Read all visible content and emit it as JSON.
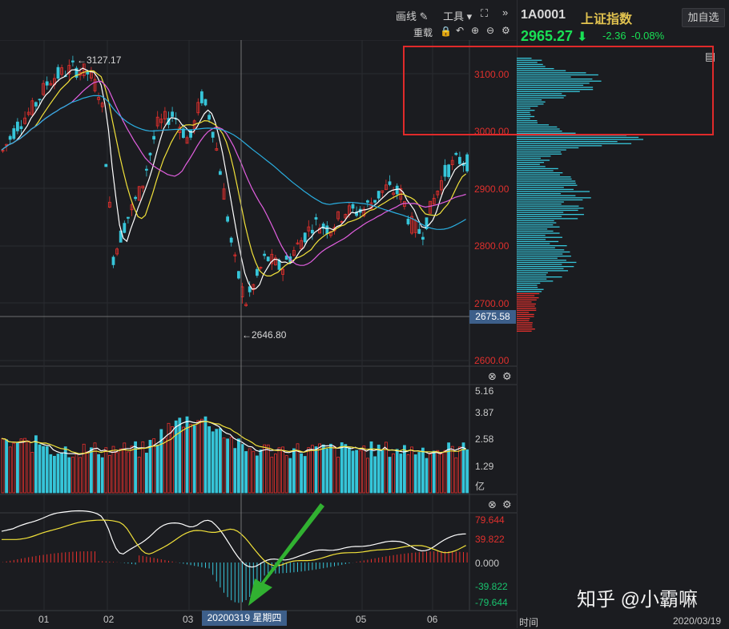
{
  "toolbar": {
    "draw_label": "画线",
    "tools_label": "工具",
    "reload_label": "重载",
    "more_label": "»"
  },
  "quote": {
    "code": "1A0001",
    "name": "上证指数",
    "add_favorite": "加自选",
    "price": "2965.27",
    "change": "-2.36",
    "change_pct": "-0.08%"
  },
  "price_axis": [
    "3100.00",
    "3000.00",
    "2900.00",
    "2800.00",
    "2700.00",
    "2600.00"
  ],
  "volume_axis": [
    "5.16",
    "3.87",
    "2.58",
    "1.29",
    "亿"
  ],
  "macd_axis": {
    "pos": [
      "79.644",
      "39.822"
    ],
    "zero": "0.000",
    "neg": [
      "-39.822",
      "-79.644"
    ]
  },
  "time_axis": [
    "01",
    "02",
    "03",
    "05",
    "06"
  ],
  "annotations": {
    "high": "←3127.17",
    "low": "←2646.80",
    "crosshair_price": "2675.58",
    "crosshair_date": "20200319 星期四"
  },
  "colors": {
    "up": "#e8302d",
    "down": "#36c5d9",
    "ma5": "#ffffff",
    "ma10": "#f2e23a",
    "ma20": "#e25fe0",
    "ma60": "#2aaee0",
    "highlight": "#e02a2a",
    "arrow": "#2fb82f"
  },
  "watermark": {
    "text": "知乎 @小霸嘛"
  },
  "profile_footer": {
    "left": "时间",
    "right": "2020/03/19"
  }
}
